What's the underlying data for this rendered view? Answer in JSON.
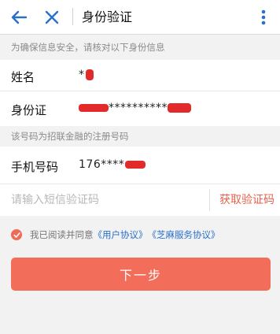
{
  "header": {
    "title": "身份验证",
    "back_icon": "back-arrow-icon",
    "close_icon": "close-icon",
    "more_icon": "more-vertical-icon",
    "accent_color": "#2a6fc9"
  },
  "notice": "为确保信息安全，请核对以下身份信息",
  "identity": {
    "name_label": "姓名",
    "name_value": "*",
    "id_label": "身份证",
    "id_value": "**********"
  },
  "phone_notice": "该号码为招联金融的注册号码",
  "phone": {
    "label": "手机号码",
    "value": "176****"
  },
  "sms": {
    "placeholder": "请输入短信验证码",
    "get_code_label": "获取验证码"
  },
  "agreement": {
    "prefix": "我已阅读并同意",
    "link1": "《用户协议》",
    "link2": "《芝麻服务协议》"
  },
  "next_button": "下一步"
}
